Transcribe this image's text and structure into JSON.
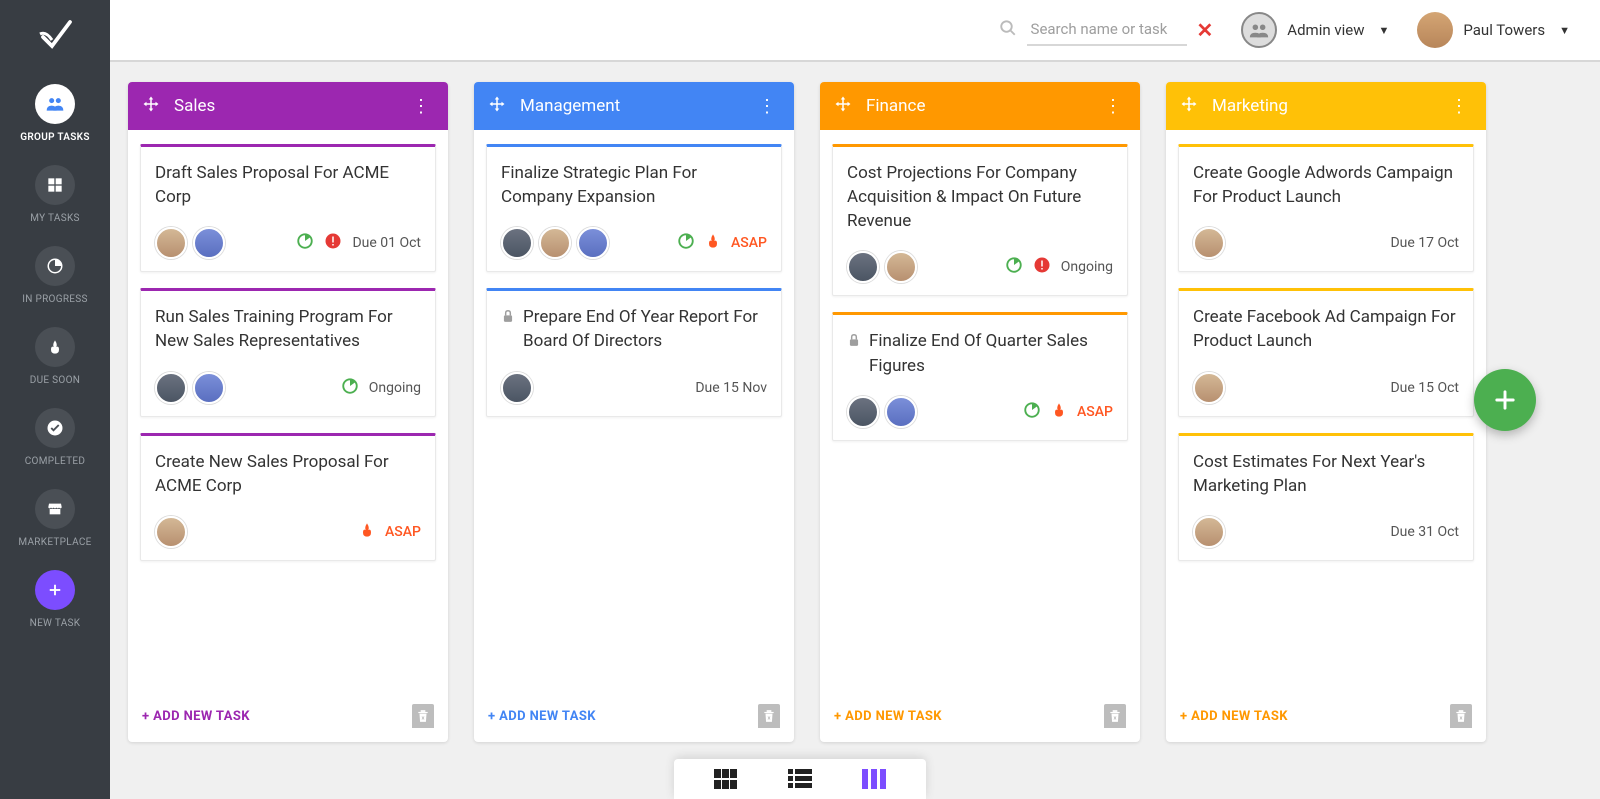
{
  "sidebar": {
    "items": [
      {
        "label": "GROUP TASKS",
        "icon": "group"
      },
      {
        "label": "MY TASKS",
        "icon": "grid"
      },
      {
        "label": "IN PROGRESS",
        "icon": "progress"
      },
      {
        "label": "DUE SOON",
        "icon": "fire"
      },
      {
        "label": "COMPLETED",
        "icon": "check"
      },
      {
        "label": "MARKETPLACE",
        "icon": "store"
      },
      {
        "label": "NEW TASK",
        "icon": "plus"
      }
    ]
  },
  "topbar": {
    "search_placeholder": "Search name or task",
    "admin_label": "Admin view",
    "user_name": "Paul Towers"
  },
  "columns": [
    {
      "title": "Sales",
      "color": "purple",
      "add_label": "+ ADD NEW TASK",
      "cards": [
        {
          "title": "Draft Sales Proposal For ACME Corp",
          "locked": false,
          "avatars": [
            "a1",
            "a2"
          ],
          "progress": true,
          "alert": true,
          "fire": false,
          "due": "Due 01 Oct",
          "asap": false
        },
        {
          "title": "Run Sales Training Program For New Sales Representatives",
          "locked": false,
          "avatars": [
            "a3",
            "a2"
          ],
          "progress": true,
          "alert": false,
          "fire": false,
          "due": "Ongoing",
          "asap": false
        },
        {
          "title": "Create New Sales Proposal For ACME Corp",
          "locked": false,
          "avatars": [
            "a1"
          ],
          "progress": false,
          "alert": false,
          "fire": true,
          "due": "ASAP",
          "asap": true
        }
      ]
    },
    {
      "title": "Management",
      "color": "blue",
      "add_label": "+ ADD NEW TASK",
      "cards": [
        {
          "title": "Finalize Strategic Plan For Company Expansion",
          "locked": false,
          "avatars": [
            "a3",
            "a1",
            "a2"
          ],
          "progress": true,
          "alert": false,
          "fire": true,
          "due": "ASAP",
          "asap": true
        },
        {
          "title": "Prepare End Of Year Report For Board Of Directors",
          "locked": true,
          "avatars": [
            "a3"
          ],
          "progress": false,
          "alert": false,
          "fire": false,
          "due": "Due 15 Nov",
          "asap": false
        }
      ]
    },
    {
      "title": "Finance",
      "color": "orange",
      "add_label": "+ ADD NEW TASK",
      "cards": [
        {
          "title": "Cost Projections For Company Acquisition & Impact On Future Revenue",
          "locked": false,
          "avatars": [
            "a3",
            "a1"
          ],
          "progress": true,
          "alert": true,
          "fire": false,
          "due": "Ongoing",
          "asap": false
        },
        {
          "title": "Finalize End Of Quarter Sales Figures",
          "locked": true,
          "avatars": [
            "a3",
            "a2"
          ],
          "progress": true,
          "alert": false,
          "fire": true,
          "due": "ASAP",
          "asap": true
        }
      ]
    },
    {
      "title": "Marketing",
      "color": "yellow",
      "add_label": "+ ADD NEW TASK",
      "cards": [
        {
          "title": "Create Google Adwords Campaign For Product Launch",
          "locked": false,
          "avatars": [
            "a1"
          ],
          "progress": false,
          "alert": false,
          "fire": false,
          "due": "Due 17 Oct",
          "asap": false
        },
        {
          "title": "Create Facebook Ad Campaign For Product Launch",
          "locked": false,
          "avatars": [
            "a1"
          ],
          "progress": false,
          "alert": false,
          "fire": false,
          "due": "Due 15 Oct",
          "asap": false
        },
        {
          "title": "Cost Estimates For Next Year's Marketing Plan",
          "locked": false,
          "avatars": [
            "a1"
          ],
          "progress": false,
          "alert": false,
          "fire": false,
          "due": "Due 31 Oct",
          "asap": false
        }
      ]
    }
  ]
}
